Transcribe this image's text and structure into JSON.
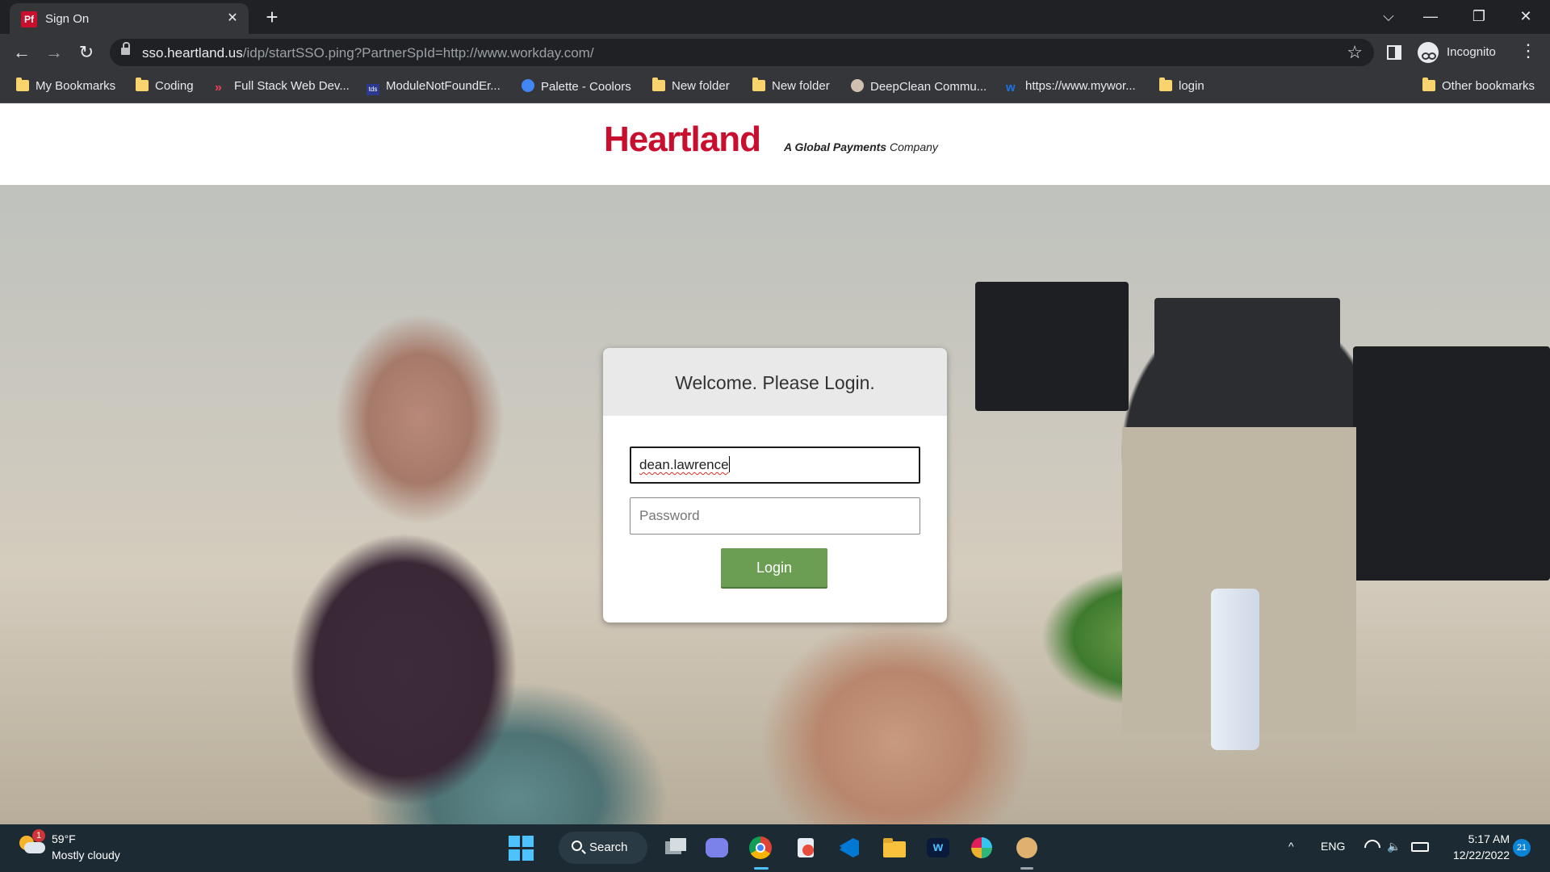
{
  "browser": {
    "tab": {
      "favicon_text": "Pf",
      "title": "Sign On",
      "close": "✕"
    },
    "new_tab": "+",
    "window_controls": {
      "tabs_search": "⌵",
      "minimize": "—",
      "restore": "❐",
      "close": "✕"
    },
    "nav": {
      "back": "←",
      "forward": "→",
      "reload": "↻"
    },
    "url": {
      "host": "sso.heartland.us",
      "path": "/idp/startSSO.ping?PartnerSpId=http://www.workday.com/"
    },
    "star": "☆",
    "profile_label": "Incognito",
    "menu": "⋮",
    "bookmarks": [
      {
        "label": "My Bookmarks",
        "icon": "folder"
      },
      {
        "label": "Coding",
        "icon": "folder"
      },
      {
        "label": "Full Stack Web Dev...",
        "icon": "red-chevron"
      },
      {
        "label": "ModuleNotFoundEr...",
        "icon": "tds"
      },
      {
        "label": "Palette - Coolors",
        "icon": "circle"
      },
      {
        "label": "New folder",
        "icon": "folder"
      },
      {
        "label": "New folder",
        "icon": "folder"
      },
      {
        "label": "DeepClean Commu...",
        "icon": "avatar"
      },
      {
        "label": "https://www.mywor...",
        "icon": "w-logo"
      },
      {
        "label": "login",
        "icon": "folder"
      }
    ],
    "other_bookmarks": "Other bookmarks"
  },
  "site": {
    "brand": "Heartland",
    "tagline_bold": "A Global Payments",
    "tagline_rest": " Company",
    "brand_color": "#c8102e"
  },
  "login": {
    "title": "Welcome. Please Login.",
    "username_value": "dean.lawrence",
    "password_placeholder": "Password",
    "button_label": "Login",
    "button_color": "#6b9e53"
  },
  "taskbar": {
    "weather_badge": "1",
    "temperature": "59°F",
    "condition": "Mostly cloudy",
    "search_label": "Search",
    "tray": {
      "chevron": "^",
      "language": "ENG",
      "wifi": "wifi-icon",
      "volume": "volume-icon",
      "battery": "battery-icon"
    },
    "time": "5:17 AM",
    "date": "12/22/2022",
    "notifications": "21"
  }
}
